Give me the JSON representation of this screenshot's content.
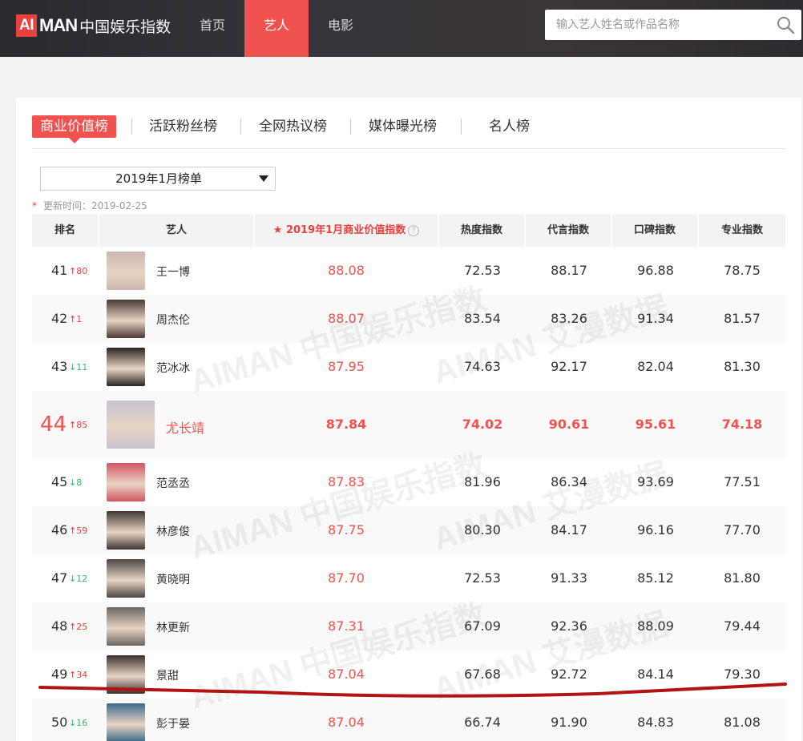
{
  "logo": {
    "ai": "AI",
    "man": "MAN",
    "cn": "中国娱乐指数"
  },
  "nav": [
    {
      "label": "首页",
      "active": false
    },
    {
      "label": "艺人",
      "active": true
    },
    {
      "label": "电影",
      "active": false
    }
  ],
  "search": {
    "placeholder": "输入艺人姓名或作品名称"
  },
  "tabs": [
    "商业价值榜",
    "活跃粉丝榜",
    "全网热议榜",
    "媒体曝光榜",
    "名人榜"
  ],
  "month_select": {
    "value": "2019年1月榜单"
  },
  "update": {
    "star": "*",
    "label": "更新时间：2019-02-25"
  },
  "table": {
    "headers": [
      "排名",
      "艺人",
      "2019年1月商业价值指数",
      "热度指数",
      "代言指数",
      "口碑指数",
      "专业指数"
    ],
    "help": "?",
    "rows": [
      {
        "rank": "41",
        "trend": "↑80",
        "dir": "up",
        "name": "王一博",
        "score": "88.08",
        "heat": "72.53",
        "endorse": "88.17",
        "word": "96.88",
        "pro": "78.75"
      },
      {
        "rank": "42",
        "trend": "↑1",
        "dir": "up",
        "name": "周杰伦",
        "score": "88.07",
        "heat": "83.54",
        "endorse": "83.26",
        "word": "91.34",
        "pro": "81.57"
      },
      {
        "rank": "43",
        "trend": "↓11",
        "dir": "down",
        "name": "范冰冰",
        "score": "87.95",
        "heat": "74.63",
        "endorse": "92.17",
        "word": "82.04",
        "pro": "81.30"
      },
      {
        "rank": "44",
        "trend": "↑85",
        "dir": "up",
        "name": "尤长靖",
        "score": "87.84",
        "heat": "74.02",
        "endorse": "90.61",
        "word": "95.61",
        "pro": "74.18"
      },
      {
        "rank": "45",
        "trend": "↓8",
        "dir": "down",
        "name": "范丞丞",
        "score": "87.83",
        "heat": "81.96",
        "endorse": "86.34",
        "word": "93.69",
        "pro": "77.51"
      },
      {
        "rank": "46",
        "trend": "↑59",
        "dir": "up",
        "name": "林彦俊",
        "score": "87.75",
        "heat": "80.30",
        "endorse": "84.17",
        "word": "96.16",
        "pro": "77.70"
      },
      {
        "rank": "47",
        "trend": "↓12",
        "dir": "down",
        "name": "黄晓明",
        "score": "87.70",
        "heat": "72.53",
        "endorse": "91.33",
        "word": "85.12",
        "pro": "81.80"
      },
      {
        "rank": "48",
        "trend": "↑25",
        "dir": "up",
        "name": "林更新",
        "score": "87.31",
        "heat": "67.09",
        "endorse": "92.36",
        "word": "88.09",
        "pro": "79.44"
      },
      {
        "rank": "49",
        "trend": "↑34",
        "dir": "up",
        "name": "景甜",
        "score": "87.04",
        "heat": "67.68",
        "endorse": "92.72",
        "word": "84.14",
        "pro": "79.30"
      },
      {
        "rank": "50",
        "trend": "↓16",
        "dir": "down",
        "name": "彭于晏",
        "score": "87.04",
        "heat": "66.74",
        "endorse": "91.90",
        "word": "84.83",
        "pro": "81.08"
      }
    ]
  },
  "watermarks": [
    "AIMAN 中国娱乐指数",
    "AIMAN 艾漫数据"
  ],
  "colors": {
    "accent": "#f0524f",
    "up": "#e8413e",
    "down": "#3bb36b",
    "annotation": "#b01414"
  }
}
